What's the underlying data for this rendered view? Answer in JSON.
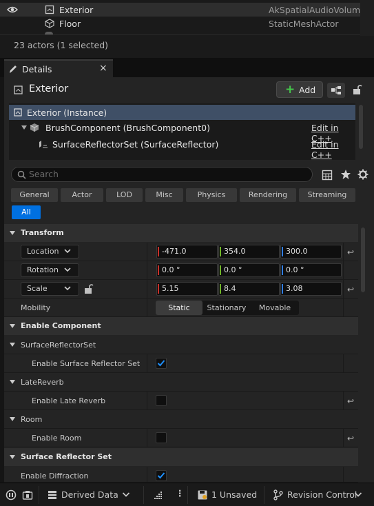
{
  "outliner": {
    "rows": [
      {
        "name": "Exterior",
        "type": "AkSpatialAudioVolume"
      },
      {
        "name": "Floor",
        "type": "StaticMeshActor"
      }
    ],
    "count_text": "23 actors (1 selected)"
  },
  "tab": {
    "label": "Details",
    "close": "×"
  },
  "details": {
    "actor_name": "Exterior",
    "add_label": "Add",
    "tree": [
      {
        "name": "Exterior (Instance)",
        "edit": ""
      },
      {
        "name": "BrushComponent (BrushComponent0)",
        "edit": "Edit in C++"
      },
      {
        "name": "SurfaceReflectorSet (SurfaceReflector)",
        "edit": "Edit in C++"
      }
    ],
    "search_placeholder": "Search",
    "filters": [
      "General",
      "Actor",
      "LOD",
      "Misc",
      "Physics",
      "Rendering",
      "Streaming"
    ],
    "filter_all": "All"
  },
  "transform": {
    "title": "Transform",
    "location": {
      "label": "Location",
      "x": "-471.0",
      "y": "354.0",
      "z": "300.0"
    },
    "rotation": {
      "label": "Rotation",
      "x": "0.0 °",
      "y": "0.0 °",
      "z": "0.0 °"
    },
    "scale": {
      "label": "Scale",
      "x": "5.15",
      "y": "8.4",
      "z": "3.08"
    },
    "mobility": {
      "label": "Mobility",
      "options": [
        "Static",
        "Stationary",
        "Movable"
      ],
      "selected": "Static"
    }
  },
  "enable_component": {
    "title": "Enable Component",
    "surface_reflector_set": {
      "group": "SurfaceReflectorSet",
      "label": "Enable Surface Reflector Set",
      "checked": true
    },
    "late_reverb": {
      "group": "LateReverb",
      "label": "Enable Late Reverb",
      "checked": false
    },
    "room": {
      "group": "Room",
      "label": "Enable Room",
      "checked": false
    }
  },
  "surface_reflector": {
    "title": "Surface Reflector Set",
    "enable_diffraction": {
      "label": "Enable Diffraction",
      "checked": true
    }
  },
  "statusbar": {
    "derived_data": "Derived Data",
    "unsaved": "1 Unsaved",
    "revision_control": "Revision Control"
  },
  "colors": {
    "accent": "#0070e0",
    "x_axis": "#c8312b",
    "y_axis": "#6fb528",
    "z_axis": "#2f7de1",
    "add_plus": "#44c64a"
  }
}
